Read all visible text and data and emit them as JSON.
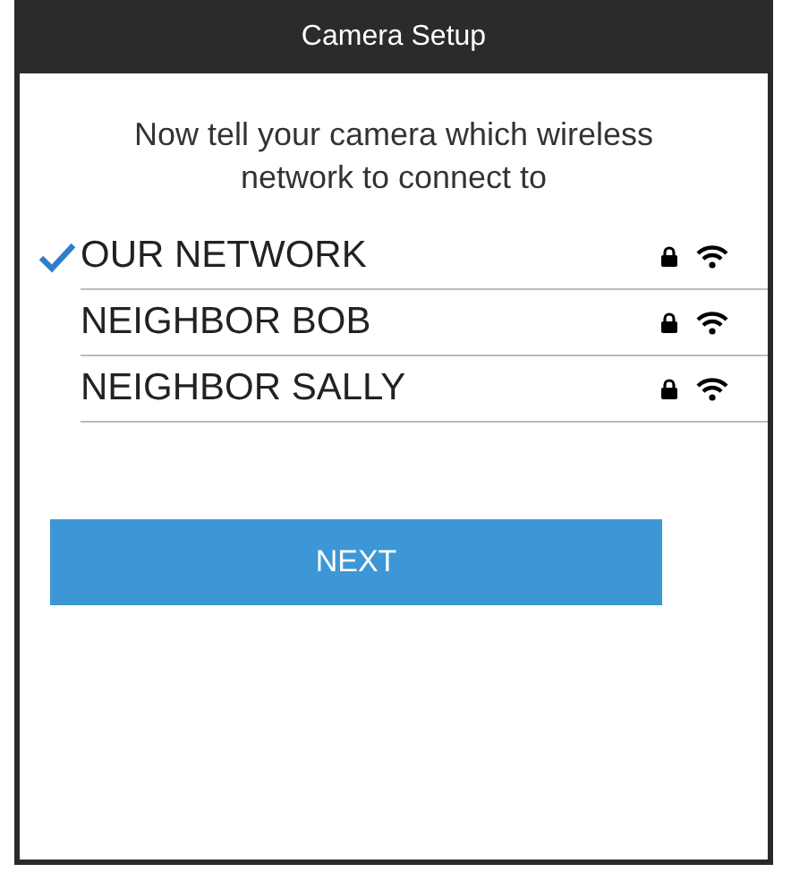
{
  "window": {
    "title": "Camera Setup"
  },
  "instructions": "Now tell your camera which wireless network to connect to",
  "networks": [
    {
      "name": "OUR NETWORK",
      "selected": true,
      "locked": true
    },
    {
      "name": "NEIGHBOR BOB",
      "selected": false,
      "locked": true
    },
    {
      "name": "NEIGHBOR SALLY",
      "selected": false,
      "locked": true
    }
  ],
  "buttons": [
    "NEXT"
  ]
}
